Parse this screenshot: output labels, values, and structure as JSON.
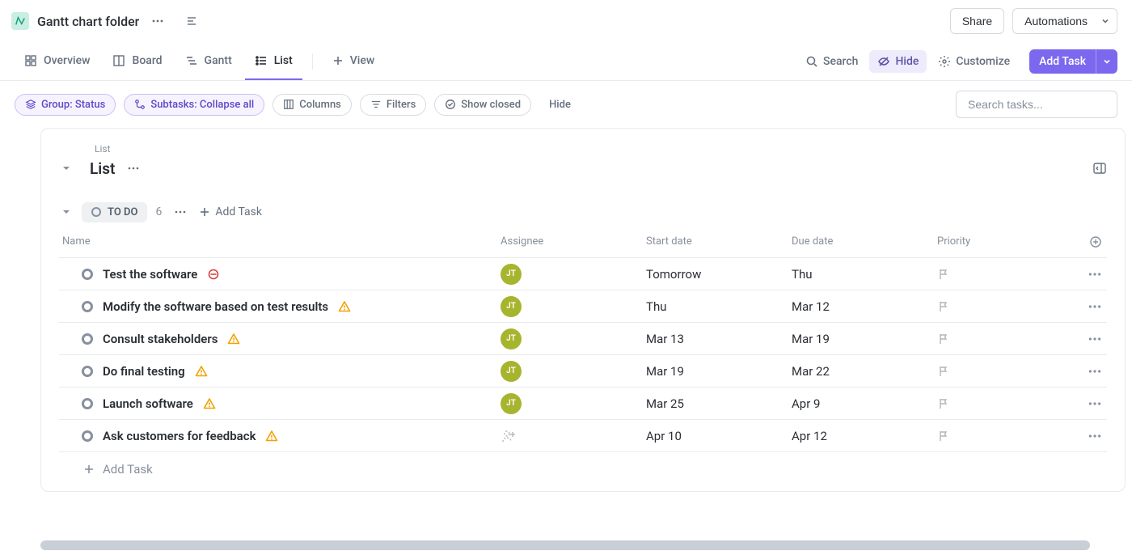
{
  "header": {
    "folder_title": "Gantt chart folder",
    "share_label": "Share",
    "automations_label": "Automations"
  },
  "views": {
    "overview": "Overview",
    "board": "Board",
    "gantt": "Gantt",
    "list": "List",
    "add_view": "View"
  },
  "actions": {
    "search": "Search",
    "hide": "Hide",
    "customize": "Customize",
    "add_task": "Add Task"
  },
  "chips": {
    "group": "Group: Status",
    "subtasks": "Subtasks: Collapse all",
    "columns": "Columns",
    "filters": "Filters",
    "show_closed": "Show closed",
    "hide": "Hide"
  },
  "search_placeholder": "Search tasks...",
  "list": {
    "breadcrumb": "List",
    "title": "List"
  },
  "group": {
    "status_label": "TO DO",
    "count": "6",
    "add_task": "Add Task"
  },
  "columns": {
    "name": "Name",
    "assignee": "Assignee",
    "start_date": "Start date",
    "due_date": "Due date",
    "priority": "Priority"
  },
  "assignee_initials": "JT",
  "tasks": [
    {
      "title": "Test the software",
      "assignee": "JT",
      "start": "Tomorrow",
      "due": "Thu",
      "icon": "block",
      "bold": true
    },
    {
      "title": "Modify the software based on test results",
      "assignee": "JT",
      "start": "Thu",
      "due": "Mar 12",
      "icon": "warn",
      "bold": true
    },
    {
      "title": "Consult stakeholders",
      "assignee": "JT",
      "start": "Mar 13",
      "due": "Mar 19",
      "icon": "warn",
      "bold": true
    },
    {
      "title": "Do final testing",
      "assignee": "JT",
      "start": "Mar 19",
      "due": "Mar 22",
      "icon": "warn",
      "bold": true
    },
    {
      "title": "Launch software",
      "assignee": "JT",
      "start": "Mar 25",
      "due": "Apr 9",
      "icon": "warn",
      "bold": true
    },
    {
      "title": "Ask customers for feedback",
      "assignee": "",
      "start": "Apr 10",
      "due": "Apr 12",
      "icon": "warn",
      "bold": true
    }
  ],
  "add_task_row": "Add Task"
}
